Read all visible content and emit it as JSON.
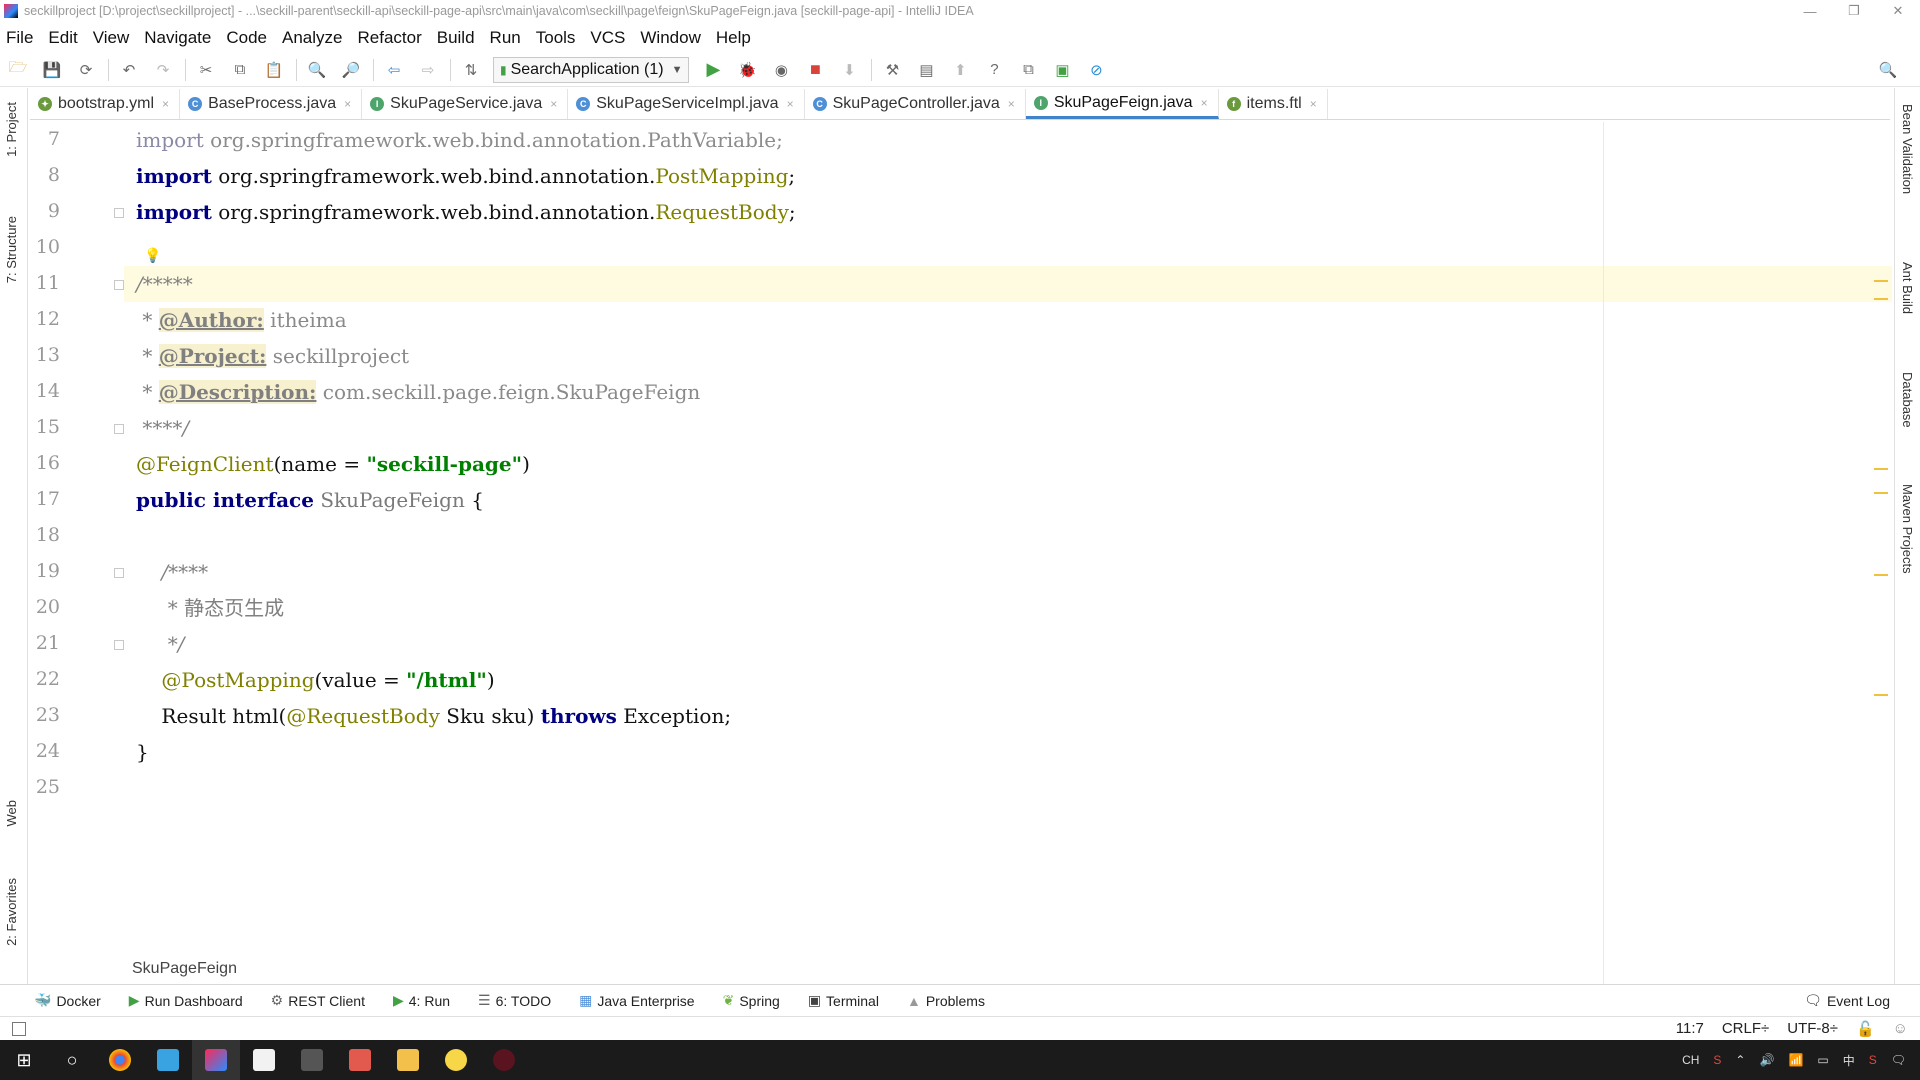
{
  "window": {
    "title": "seckillproject [D:\\project\\seckillproject] - ...\\seckill-parent\\seckill-api\\seckill-page-api\\src\\main\\java\\com\\seckill\\page\\feign\\SkuPageFeign.java [seckill-page-api] - IntelliJ IDEA",
    "controls": [
      "—",
      "❐",
      "✕"
    ]
  },
  "menu": [
    "File",
    "Edit",
    "View",
    "Navigate",
    "Code",
    "Analyze",
    "Refactor",
    "Build",
    "Run",
    "Tools",
    "VCS",
    "Window",
    "Help"
  ],
  "toolbar": {
    "run_config": "SearchApplication (1)"
  },
  "tabs": [
    {
      "label": "bootstrap.yml",
      "icon": "yml-file-icon",
      "color": "#6a9a3d",
      "glyph": "✦"
    },
    {
      "label": "BaseProcess.java",
      "icon": "class-icon",
      "color": "#4e8fd6",
      "glyph": "C"
    },
    {
      "label": "SkuPageService.java",
      "icon": "interface-icon",
      "color": "#4ea56b",
      "glyph": "I"
    },
    {
      "label": "SkuPageServiceImpl.java",
      "icon": "class-icon",
      "color": "#4e8fd6",
      "glyph": "C"
    },
    {
      "label": "SkuPageController.java",
      "icon": "class-icon",
      "color": "#4e8fd6",
      "glyph": "C"
    },
    {
      "label": "SkuPageFeign.java",
      "icon": "interface-icon",
      "color": "#4ea56b",
      "glyph": "I",
      "active": true
    },
    {
      "label": "items.ftl",
      "icon": "ftl-file-icon",
      "color": "#6a9a3d",
      "glyph": "f"
    }
  ],
  "left_strip": [
    "1: Project",
    "7: Structure",
    "Web",
    "2: Favorites"
  ],
  "right_strip": [
    "Bean Validation",
    "Ant Build",
    "Database",
    "Maven Projects"
  ],
  "editor": {
    "line_numbers": [
      "7",
      "8",
      "9",
      "10",
      "11",
      "12",
      "13",
      "14",
      "15",
      "16",
      "17",
      "18",
      "19",
      "20",
      "21",
      "22",
      "23",
      "24",
      "25"
    ],
    "lines": {
      "l7": {
        "kw": "import",
        "pkg": " org.springframework.web.bind.annotation.",
        "cls": "PathVariable",
        "end": ";"
      },
      "l8": {
        "kw": "import",
        "pkg": " org.springframework.web.bind.annotation.",
        "cls": "PostMapping",
        "end": ";"
      },
      "l9": {
        "kw": "import",
        "pkg": " org.springframework.web.bind.annotation.",
        "cls": "RequestBody",
        "end": ";"
      },
      "l11": {
        "text": "/*****"
      },
      "l12": {
        "star": " * ",
        "tag": "@Author:",
        "val": " itheima"
      },
      "l13": {
        "star": " * ",
        "tag": "@Project:",
        "val": " seckillproject"
      },
      "l14": {
        "star": " * ",
        "tag": "@Description:",
        "val": " com.seckill.page.feign.SkuPageFeign"
      },
      "l15": {
        "text": " ****/"
      },
      "l16": {
        "ann": "@FeignClient",
        "open": "(name = ",
        "str": "\"seckill-page\"",
        "close": ")"
      },
      "l17": {
        "kw1": "public",
        "kw2": " interface",
        "name": " SkuPageFeign",
        "brace": " {"
      },
      "l19": {
        "text": "    /****"
      },
      "l20": {
        "text": "     * 静态页生成"
      },
      "l21": {
        "text": "     */"
      },
      "l22": {
        "ann": "    @PostMapping",
        "open": "(value = ",
        "str": "\"/html\"",
        "close": ")"
      },
      "l23": {
        "ret": "    Result html(",
        "ann": "@RequestBody",
        "params": " Sku sku) ",
        "kw": "throws",
        "exc": " Exception;"
      },
      "l24": {
        "text": "}"
      }
    },
    "breadcrumb": "SkuPageFeign"
  },
  "bottom_tools": [
    {
      "label": "Docker",
      "icon": "docker-icon",
      "glyph": "🐳",
      "color": "#2496ed"
    },
    {
      "label": "Run Dashboard",
      "icon": "run-dashboard-icon",
      "glyph": "▶",
      "color": "#41a143"
    },
    {
      "label": "REST Client",
      "icon": "rest-client-icon",
      "glyph": "⚙",
      "color": "#666"
    },
    {
      "label": "4: Run",
      "icon": "run-icon",
      "glyph": "▶",
      "color": "#41a143"
    },
    {
      "label": "6: TODO",
      "icon": "todo-icon",
      "glyph": "☰",
      "color": "#666"
    },
    {
      "label": "Java Enterprise",
      "icon": "java-enterprise-icon",
      "glyph": "▦",
      "color": "#4e8fd6"
    },
    {
      "label": "Spring",
      "icon": "spring-icon",
      "glyph": "❦",
      "color": "#6db33f"
    },
    {
      "label": "Terminal",
      "icon": "terminal-icon",
      "glyph": "▣",
      "color": "#444"
    },
    {
      "label": "Problems",
      "icon": "problems-icon",
      "glyph": "▲",
      "color": "#999"
    }
  ],
  "event_log": "Event Log",
  "status": {
    "position": "11:7",
    "line_sep": "CRLF÷",
    "encoding": "UTF-8÷"
  },
  "tray": {
    "lang": "中"
  }
}
